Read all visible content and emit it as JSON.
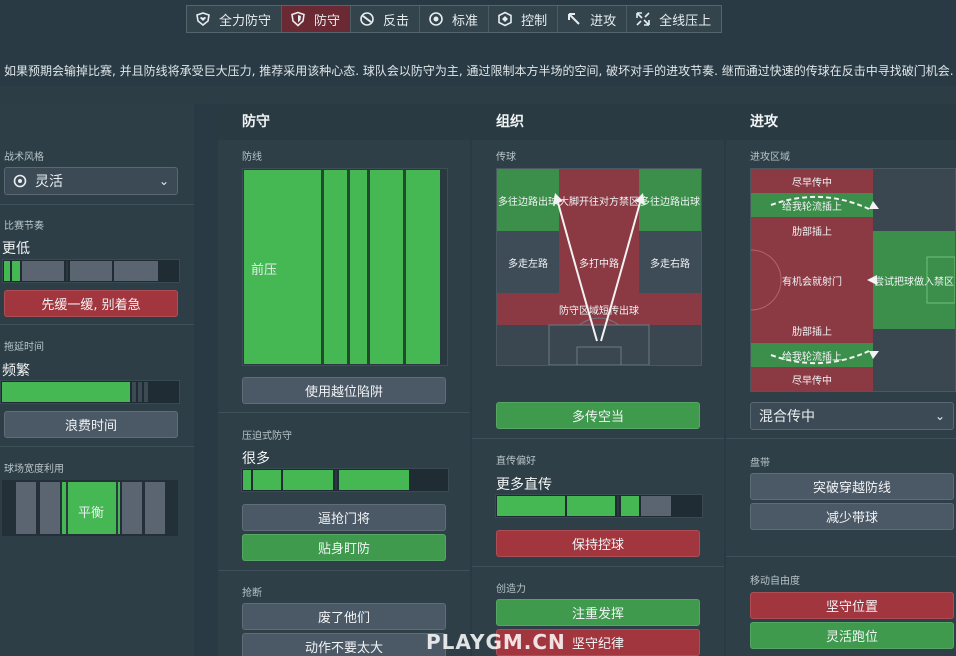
{
  "tabs": [
    {
      "label": "全力防守",
      "icon": "heart-shield-icon"
    },
    {
      "label": "防守",
      "icon": "shield-icon"
    },
    {
      "label": "反击",
      "icon": "counter-icon"
    },
    {
      "label": "标准",
      "icon": "standard-icon"
    },
    {
      "label": "控制",
      "icon": "control-icon"
    },
    {
      "label": "进攻",
      "icon": "attack-arrow-icon"
    },
    {
      "label": "全线压上",
      "icon": "full-press-icon"
    }
  ],
  "description": "如果预期会输掉比赛, 并且防线将承受巨大压力, 推荐采用该种心态. 球队会以防守为主, 通过限制本方半场的空间, 破坏对手的进攻节奏. 继而通过快速的传球在反击中寻找破门机会.",
  "left": {
    "style_label": "战术风格",
    "style_value": "灵活",
    "tempo_label": "比赛节奏",
    "tempo_value": "更低",
    "tempo_level": 0.1,
    "tempo_button": "先缓一缓, 别着急",
    "timewaste_label": "拖延时间",
    "timewaste_value": "频繁",
    "timewaste_level": 0.72,
    "timewaste_button": "浪费时间",
    "width_label": "球场宽度利用",
    "width_value": "平衡"
  },
  "defence": {
    "title": "防守",
    "line_label": "防线",
    "line_value": "前压",
    "offside_button": "使用越位陷阱",
    "press_label": "压迫式防守",
    "press_value": "很多",
    "press_level": 0.8,
    "press_btn1": "逼抢门将",
    "press_btn2": "贴身盯防",
    "tackle_label": "抢断",
    "tackle_btn1": "废了他们",
    "tackle_btn2": "动作不要太大"
  },
  "organisation": {
    "title": "组织",
    "passing_label": "传球",
    "zones": {
      "tl": "多往边路出球",
      "tc": "大脚开往对方禁区",
      "tr": "多往边路出球",
      "ml": "多走左路",
      "mc": "多打中路",
      "mr": "多走右路",
      "bottom": "防守区域短传出球"
    },
    "pass_button": "多传空当",
    "direct_label": "直传偏好",
    "direct_value": "更多直传",
    "direct_level": 0.68,
    "direct_button": "保持控球",
    "creative_label": "创造力",
    "creative_btn1": "注重发挥",
    "creative_btn2": "坚守纪律"
  },
  "attack": {
    "title": "进攻",
    "zone_label": "进攻区域",
    "zones": {
      "z1": "尽早传中",
      "z2": "给我轮流插上",
      "z3": "肋部插上",
      "z4": "有机会就射门",
      "z5": "肋部插上",
      "z6": "给我轮流插上",
      "z7": "尽早传中",
      "box": "尝试把球做入禁区"
    },
    "cross_value": "混合传中",
    "dribble_label": "盘带",
    "dribble_btn1": "突破穿越防线",
    "dribble_btn2": "减少带球",
    "freedom_label": "移动自由度",
    "freedom_btn1": "坚守位置",
    "freedom_btn2": "灵活跑位"
  },
  "watermark": "PLAYGM.CN",
  "colors": {
    "red": "#a2363f",
    "green": "#3f9a4e",
    "grey": "#4b5866",
    "active_tab": "#6b2a33"
  }
}
